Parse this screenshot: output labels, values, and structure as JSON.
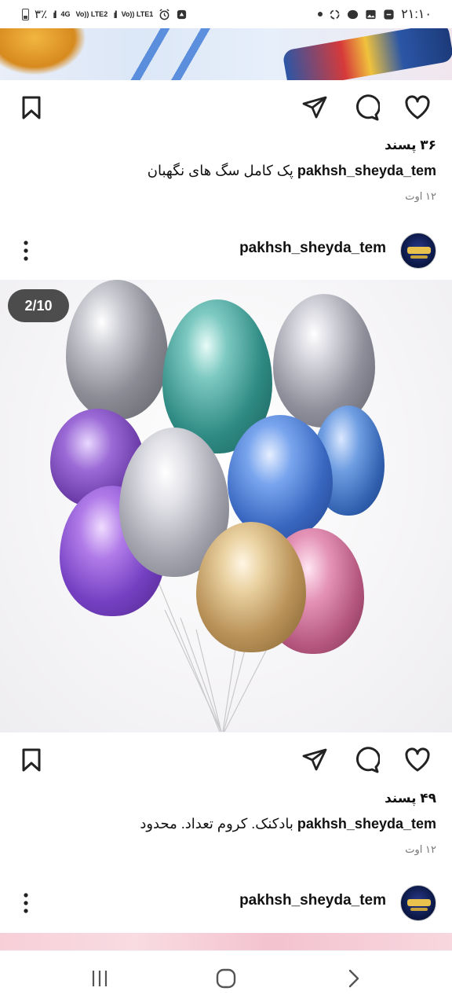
{
  "status_bar": {
    "time": "۲۱:۱۰",
    "battery": "۳٪",
    "net1": "4G",
    "net2": "Vo)) LTE2",
    "net3": "Vo)) LTE1"
  },
  "posts": [
    {
      "likes": "۳۶ پسند",
      "caption_user": "pakhsh_sheyda_tem",
      "caption_text": "پک کامل سگ های نگهبان",
      "date": "۱۲ اوت"
    },
    {
      "username": "pakhsh_sheyda_tem",
      "image_counter": "2/10",
      "likes": "۴۹ پسند",
      "caption_user": "pakhsh_sheyda_tem",
      "caption_text": "بادکنک. کروم تعداد. محدود",
      "date": "۱۲ اوت"
    },
    {
      "username": "pakhsh_sheyda_tem"
    }
  ],
  "colors": {
    "text": "#111111",
    "muted": "#777777",
    "icon": "#222222"
  },
  "icons": [
    "bookmark-icon",
    "share-icon",
    "comment-icon",
    "heart-icon",
    "more-icon",
    "recents-icon",
    "home-icon",
    "back-icon"
  ]
}
